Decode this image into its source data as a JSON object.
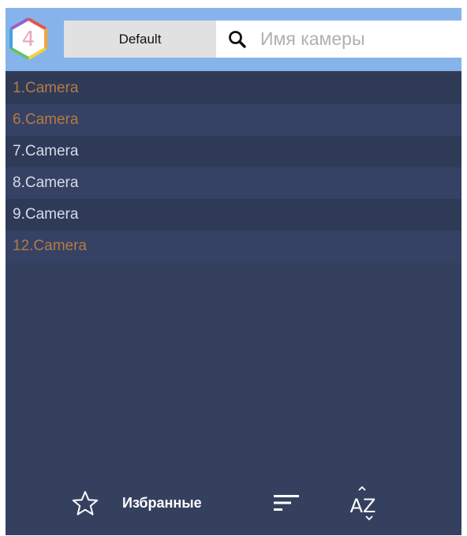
{
  "header": {
    "logo_text": "4",
    "layout_label": "Default",
    "search": {
      "placeholder": "Имя камеры",
      "value": ""
    }
  },
  "cameras": [
    {
      "label": "1.Camera",
      "status": "warning"
    },
    {
      "label": "6.Camera",
      "status": "warning"
    },
    {
      "label": "7.Camera",
      "status": "normal"
    },
    {
      "label": "8.Camera",
      "status": "normal"
    },
    {
      "label": "9.Camera",
      "status": "normal"
    },
    {
      "label": "12.Camera",
      "status": "warning"
    }
  ],
  "footer": {
    "favorites_label": "Избранные",
    "sort_icon": "sort-lines-icon",
    "az_icon": "sort-az-icon",
    "az_text": "AZ"
  },
  "colors": {
    "header_bg": "#86b4ea",
    "panel_bg": "#35405f",
    "warning_text": "#b47a47",
    "normal_text": "#d5dcea"
  }
}
